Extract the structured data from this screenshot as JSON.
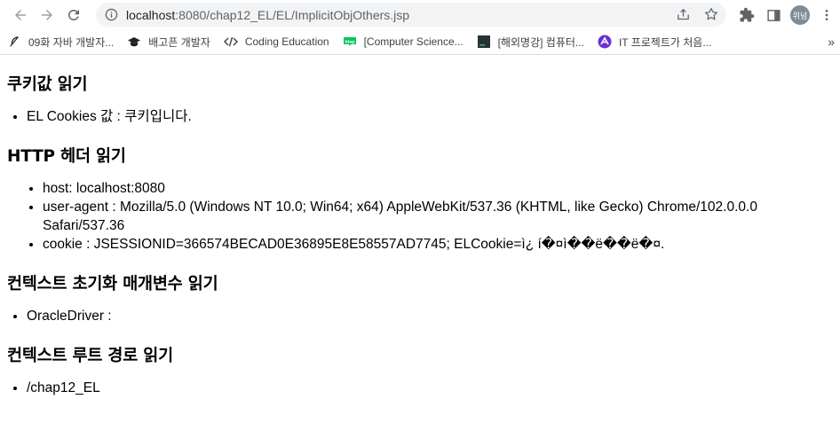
{
  "browser": {
    "url_host": "localhost",
    "url_rest": ":8080/chap12_EL/EL/ImplicitObjOthers.jsp",
    "profile_initials": "위넘",
    "bookmarks": [
      {
        "label": "09화 자바 개발자...",
        "icon": "feather-icon"
      },
      {
        "label": "배고픈 개발자",
        "icon": "graduation-cap-icon"
      },
      {
        "label": "Coding Education",
        "icon": "code-icon"
      },
      {
        "label": "[Computer Science...",
        "icon": "blog-icon"
      },
      {
        "label": "[해외명강] 컴퓨터...",
        "icon": "terminal-icon"
      },
      {
        "label": "IT 프로젝트가 처음...",
        "icon": "purple-logo-icon"
      }
    ],
    "more_label": "»"
  },
  "sections": {
    "cookie": {
      "heading": "쿠키값 읽기",
      "items": [
        "EL Cookies 값 : 쿠키입니다."
      ]
    },
    "header": {
      "heading": "HTTP 헤더 읽기",
      "items": [
        "host: localhost:8080",
        "user-agent : Mozilla/5.0 (Windows NT 10.0; Win64; x64) AppleWebKit/537.36 (KHTML, like Gecko) Chrome/102.0.0.0 Safari/537.36",
        "cookie : JSESSIONID=366574BECAD0E36895E8E58557AD7745; ELCookie=ì¿ í�¤ì��ë��ë�¤."
      ]
    },
    "init_param": {
      "heading": "컨텍스트 초기화 매개변수 읽기",
      "items": [
        "OracleDriver :"
      ]
    },
    "context_root": {
      "heading": "컨텍스트 루트 경로 읽기",
      "items": [
        "/chap12_EL"
      ]
    }
  }
}
